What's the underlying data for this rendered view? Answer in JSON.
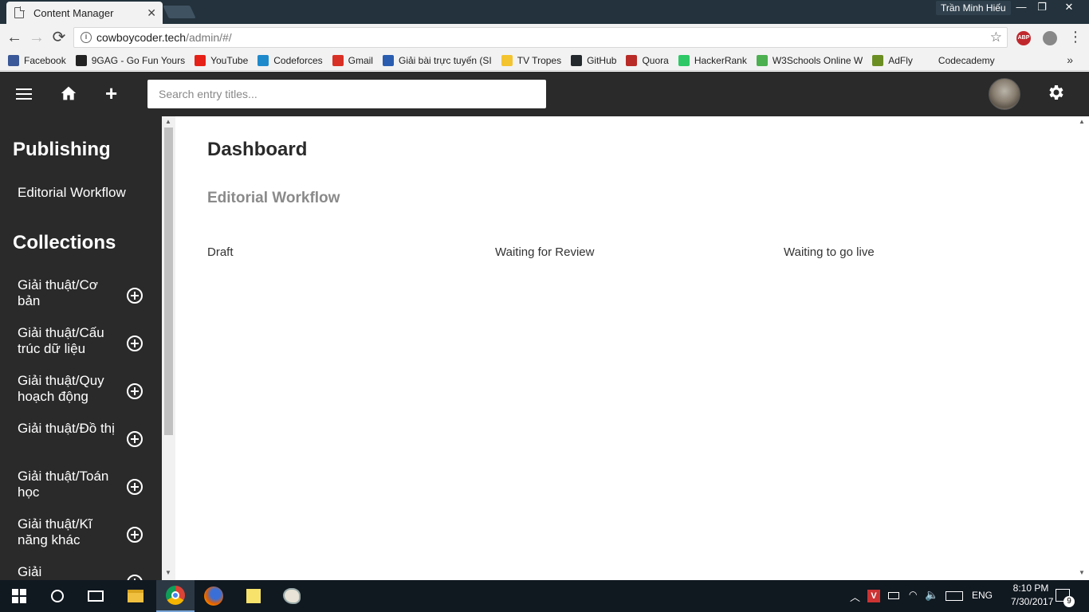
{
  "browser": {
    "tab_title": "Content Manager",
    "tab_close": "✕",
    "profile_name": "Trần Minh Hiếu",
    "window_controls": {
      "minimize": "—",
      "restore": "❐",
      "close": "✕"
    },
    "nav": {
      "back": "←",
      "forward": "→",
      "reload": "⟳"
    },
    "url_host": "cowboycoder.tech",
    "url_path": "/admin/#/",
    "star": "☆",
    "ext_abp": "ABP",
    "menu": "⋮"
  },
  "bookmarks": {
    "items": [
      {
        "label": "Facebook",
        "color": "#3b5998"
      },
      {
        "label": "9GAG - Go Fun Yours",
        "color": "#222222"
      },
      {
        "label": "YouTube",
        "color": "#e62117"
      },
      {
        "label": "Codeforces",
        "color": "#1f8acb"
      },
      {
        "label": "Gmail",
        "color": "#d93025"
      },
      {
        "label": "Giải bài trực tuyến (SI",
        "color": "#2a5db0"
      },
      {
        "label": "TV Tropes",
        "color": "#f4c430"
      },
      {
        "label": "GitHub",
        "color": "#24292e"
      },
      {
        "label": "Quora",
        "color": "#b92b27"
      },
      {
        "label": "HackerRank",
        "color": "#2ec866"
      },
      {
        "label": "W3Schools Online W",
        "color": "#4caf50"
      },
      {
        "label": "AdFly",
        "color": "#6b8e23"
      },
      {
        "label": "Codecademy",
        "color": "#f2f2f2"
      }
    ],
    "more": "»"
  },
  "header": {
    "search_placeholder": "Search entry titles...",
    "plus": "+"
  },
  "sidebar": {
    "publishing_title": "Publishing",
    "editorial_link": "Editorial Workflow",
    "collections_title": "Collections",
    "collections": [
      "Giải thuật/Cơ bản",
      "Giải thuật/Cấu trúc dữ liệu",
      "Giải thuật/Quy hoạch động",
      "Giải thuật/Đồ thị",
      "Giải thuật/Toán học",
      "Giải thuật/Kĩ năng khác",
      "Giải"
    ]
  },
  "main": {
    "title": "Dashboard",
    "subtitle": "Editorial Workflow",
    "columns": [
      "Draft",
      "Waiting for Review",
      "Waiting to go live"
    ]
  },
  "taskbar": {
    "lang": "ENG",
    "time": "8:10 PM",
    "date": "7/30/2017",
    "notifications": "9"
  }
}
